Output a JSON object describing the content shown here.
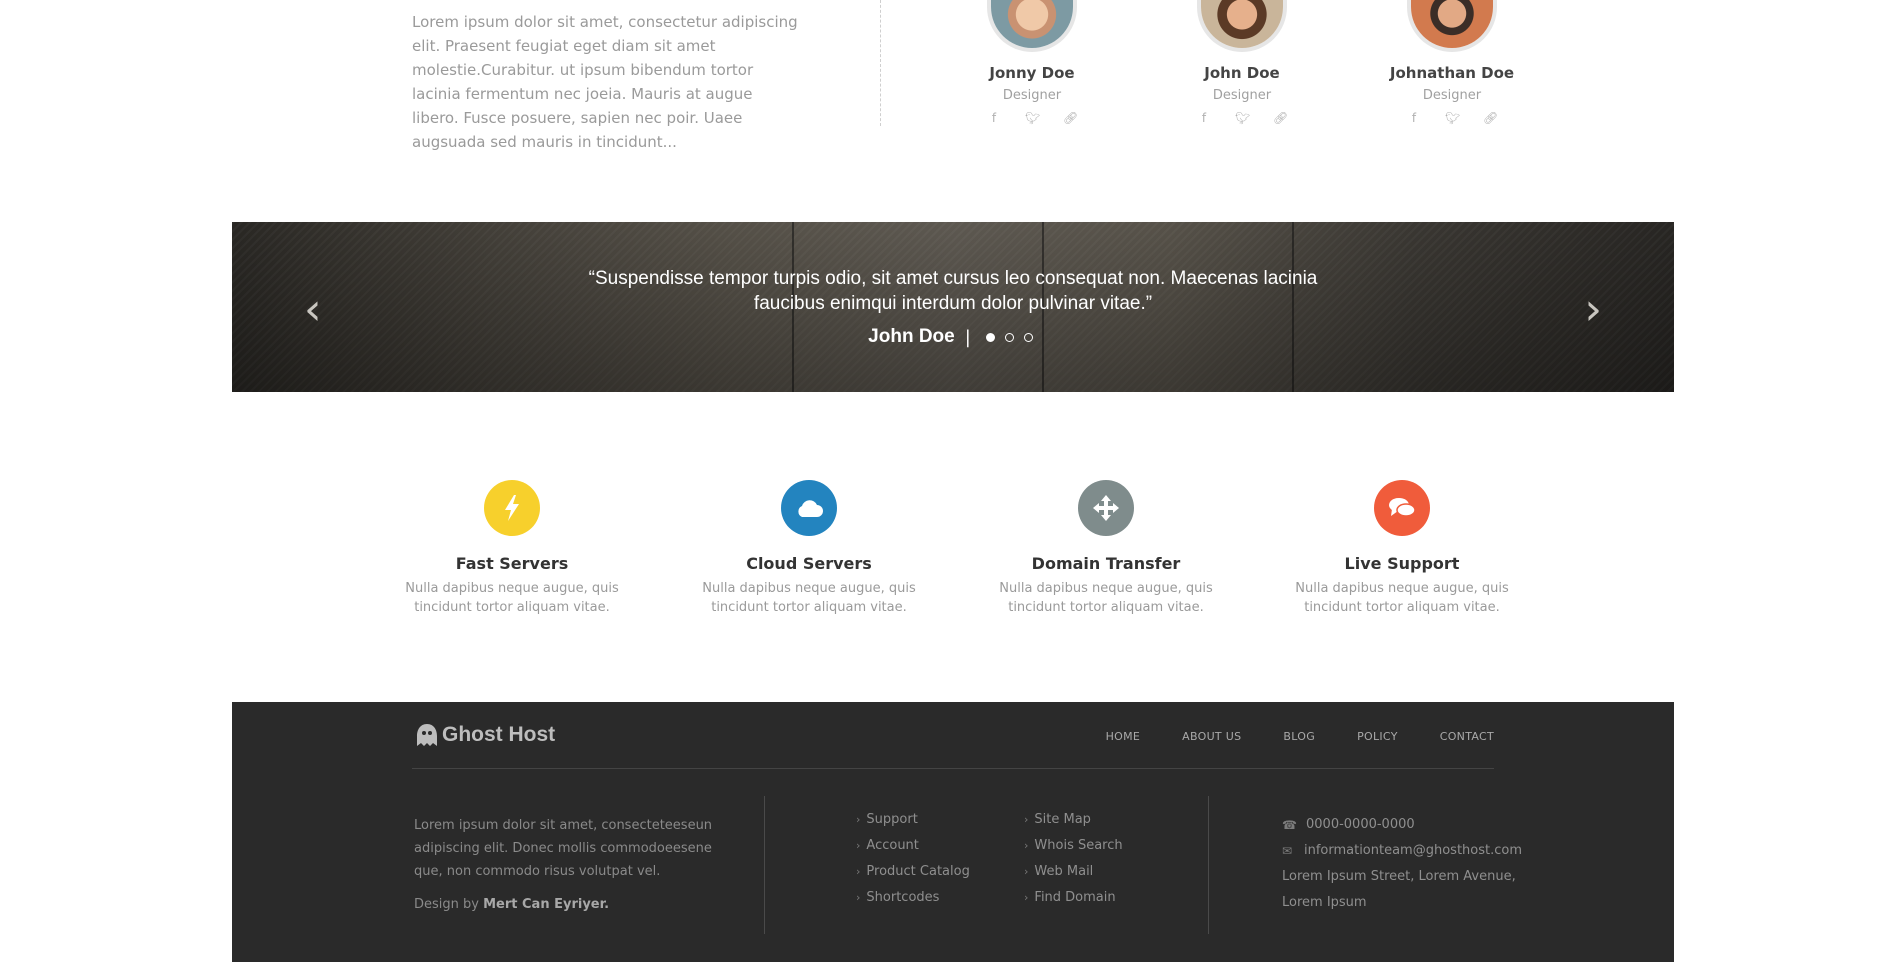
{
  "about": {
    "text": "Lorem ipsum dolor sit amet, consectetur adipiscing elit. Praesent feugiat eget diam sit amet molestie.Curabitur. ut ipsum bibendum tortor lacinia fermentum nec joeia. Mauris at augue libero. Fusce posuere, sapien nec poir. Uaee augsuada sed mauris in tincidunt..."
  },
  "team": [
    {
      "name": "Jonny Doe",
      "role": "Designer"
    },
    {
      "name": "John Doe",
      "role": "Designer"
    },
    {
      "name": "Johnathan Doe",
      "role": "Designer"
    }
  ],
  "social_icons": [
    "facebook-icon",
    "twitter-icon",
    "link-icon"
  ],
  "testimonial": {
    "quote": "“Suspendisse tempor turpis odio, sit amet cursus leo consequat non. Maecenas lacinia faucibus enimqui interdum dolor pulvinar vitae.”",
    "author": "John Doe",
    "separator": "|",
    "slides": 3,
    "active_slide": 1
  },
  "features": [
    {
      "title": "Fast Servers",
      "desc": "Nulla dapibus neque augue, quis tincidunt tortor aliquam vitae.",
      "icon": "bolt-icon",
      "color": "#f7d02c",
      "glyph": "ϟ"
    },
    {
      "title": "Cloud Servers",
      "desc": "Nulla dapibus neque augue, quis tincidunt tortor aliquam vitae.",
      "icon": "cloud-icon",
      "color": "#2384bf",
      "glyph": "☁"
    },
    {
      "title": "Domain Transfer",
      "desc": "Nulla dapibus neque augue, quis tincidunt tortor aliquam vitae.",
      "icon": "move-arrows-icon",
      "color": "#7f8c8c",
      "glyph": "✥"
    },
    {
      "title": "Live Support",
      "desc": "Nulla dapibus neque augue, quis tincidunt tortor aliquam vitae.",
      "icon": "chat-bubbles-icon",
      "color": "#f05c3b",
      "glyph": "●"
    }
  ],
  "footer": {
    "logo_text": "Ghost Host",
    "nav": [
      "HOME",
      "ABOUT US",
      "BLOG",
      "POLICY",
      "CONTACT"
    ],
    "about_text": "Lorem ipsum dolor sit amet, consecteteeseun adipiscing elit. Donec mollis commodoeesene que, non commodo risus volutpat vel.",
    "credit_prefix": "Design by",
    "credit_name": "Mert Can Eyriyer.",
    "links_col1": [
      "Support",
      "Account",
      "Product Catalog",
      "Shortcodes"
    ],
    "links_col2": [
      "Site Map",
      "Whois Search",
      "Web Mail",
      "Find Domain"
    ],
    "phone": "0000-0000-0000",
    "email": "informationteam@ghosthost.com",
    "address": "Lorem Ipsum Street, Lorem Avenue, Lorem Ipsum"
  },
  "colors": {
    "footer_bg": "#2a2a2a",
    "banner_text": "#ffffff"
  }
}
